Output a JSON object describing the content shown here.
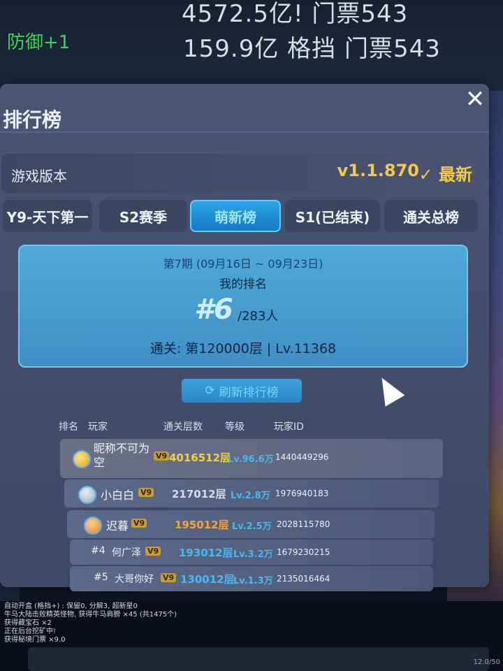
{
  "hud": {
    "line1": "4572.5亿! 门票543",
    "line2": "159.9亿 格挡 门票543",
    "buff": "防御+1"
  },
  "panel": {
    "title": "排行榜",
    "close_label": "✕"
  },
  "version": {
    "label": "游戏版本",
    "value": "v1.1.870",
    "status": "✓ 最新"
  },
  "tabs": [
    {
      "label": "Y9-天下第一"
    },
    {
      "label": "S2赛季"
    },
    {
      "label": "萌新榜"
    },
    {
      "label": "S1(已结束)"
    },
    {
      "label": "通关总榜"
    }
  ],
  "my_rank": {
    "period": "第7期 (09月16日 ~ 09月23日)",
    "label": "我的排名",
    "rank": "#6",
    "total": "/283人",
    "clear_info": "通关: 第120000层 | Lv.11368"
  },
  "refresh": {
    "label": "刷新排行榜"
  },
  "table": {
    "headers": {
      "rank": "排名",
      "player": "玩家",
      "floors": "通关层数",
      "level": "等级",
      "player_id": "玩家ID"
    },
    "rows": [
      {
        "rank": "",
        "vip": "V9",
        "name": "昵称不可为空",
        "floors": "4016512层",
        "level": "Lv.96.6万",
        "pid": "1440449296"
      },
      {
        "rank": "",
        "vip": "V9",
        "name": "小白白",
        "floors": "217012层",
        "level": "Lv.2.8万",
        "pid": "1976940183"
      },
      {
        "rank": "",
        "vip": "V9",
        "name": "迟暮",
        "floors": "195012层",
        "level": "Lv.2.5万",
        "pid": "2028115780"
      },
      {
        "rank": "#4",
        "vip": "V9",
        "name": "何广泽",
        "floors": "193012层",
        "level": "Lv.3.2万",
        "pid": "1679230215"
      },
      {
        "rank": "#5",
        "vip": "V9",
        "name": "大哥你好",
        "floors": "130012层",
        "level": "Lv.1.3万",
        "pid": "2135016464"
      }
    ]
  },
  "log": [
    "自动开盒 (格挡+) : 保留0, 分解3, 超新星0",
    "牛马大陆击败精英怪物, 获得牛马肩膀 ×45 (共1475个)",
    "获得藏宝石 ×2",
    "正在后台挖矿中!",
    "获得秘境门票 ×9.0"
  ],
  "bottom": {
    "counter": "12.0/50"
  }
}
